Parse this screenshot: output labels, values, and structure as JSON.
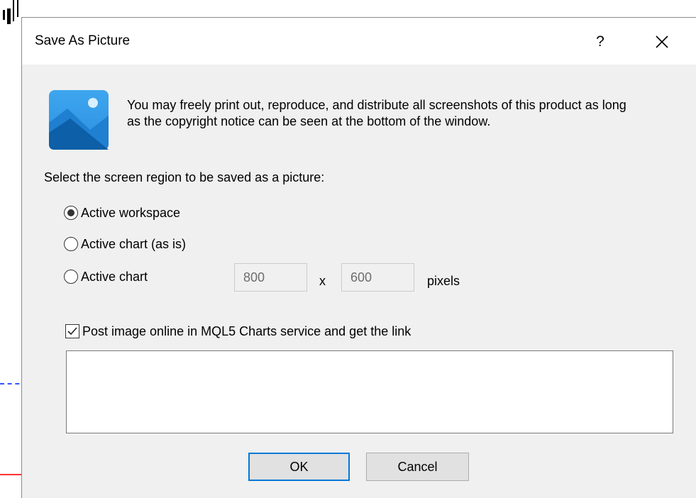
{
  "dialog": {
    "title": "Save As Picture",
    "help_label": "?",
    "notice": "You may freely print out, reproduce, and distribute all screenshots of this product as long as the copyright notice can be seen at the bottom of the window.",
    "select_label": "Select the screen region to be saved as a picture:",
    "options": [
      {
        "label": "Active workspace",
        "selected": true
      },
      {
        "label": "Active chart (as is)",
        "selected": false
      },
      {
        "label": "Active chart",
        "selected": false
      }
    ],
    "width_value": "800",
    "height_value": "600",
    "times_label": "x",
    "pixels_label": "pixels",
    "post_online_label": "Post image online in MQL5 Charts service and get the link",
    "post_online_checked": true,
    "link_text": "",
    "ok_label": "OK",
    "cancel_label": "Cancel"
  },
  "icons": {
    "photo": "picture-icon",
    "close": "close-icon"
  },
  "colors": {
    "accent": "#0078d7",
    "dialog_bg": "#f0f0f0",
    "icon_light": "#3a9be8",
    "icon_dark": "#0d5fa8"
  }
}
